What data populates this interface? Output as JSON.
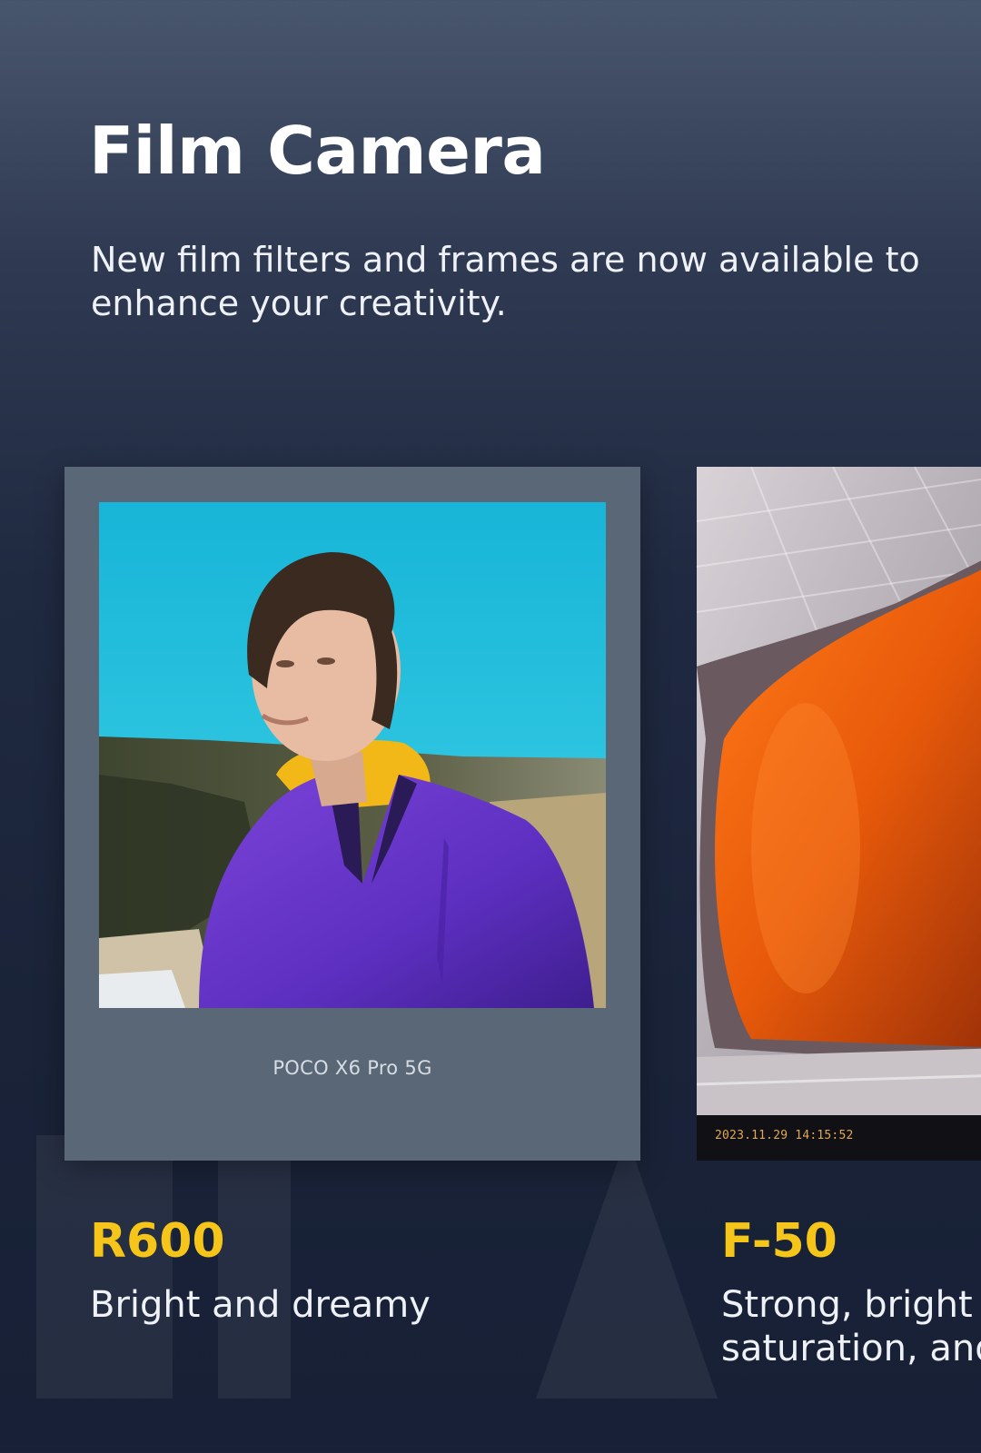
{
  "header": {
    "title": "Film Camera",
    "subtitle": "New film filters and frames are now available to enhance your creativity."
  },
  "cards": [
    {
      "frame_caption": "POCO X6 Pro 5G",
      "name": "R600",
      "description": "Bright and dreamy",
      "photo_icon": "portrait-photo"
    },
    {
      "date_stamp": "2023.11.29  14:15:52",
      "name": "F-50",
      "description": "Strong, bright co\nsaturation, and",
      "photo_icon": "orange-structure-photo"
    }
  ],
  "colors": {
    "accent": "#f6c51a",
    "frame": "#5a6776",
    "background_top": "#48566d",
    "background_bottom": "#172036"
  }
}
